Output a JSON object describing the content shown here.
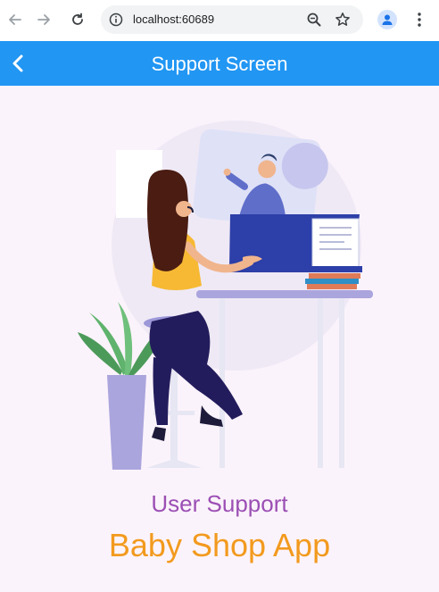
{
  "browser": {
    "url": "localhost:60689"
  },
  "appbar": {
    "title": "Support Screen"
  },
  "content": {
    "subtitle": "User Support",
    "headline": "Baby Shop App"
  },
  "colors": {
    "appbar": "#2196f3",
    "background": "#fbf3fb",
    "subtitle": "#9b4fb4",
    "headline": "#f29a1e"
  },
  "icons": {
    "back": "arrow-left-icon",
    "forward": "arrow-right-icon",
    "reload": "reload-icon",
    "info": "info-icon",
    "zoom": "zoom-icon",
    "star": "star-icon",
    "profile": "profile-icon",
    "menu": "more-vert-icon",
    "appbar_back": "chevron-left-icon"
  }
}
